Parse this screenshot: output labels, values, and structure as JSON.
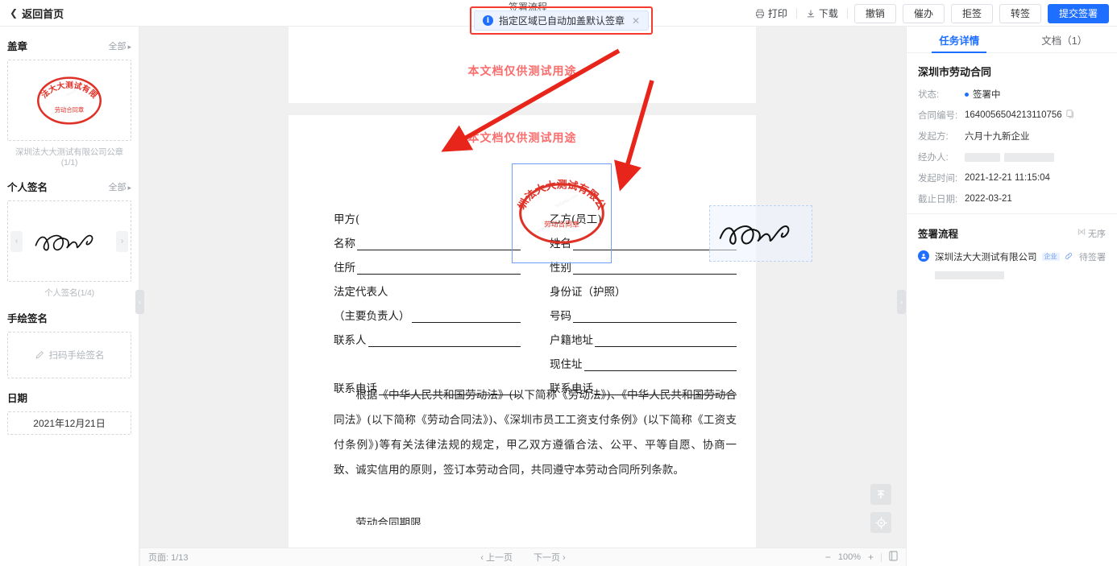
{
  "topbar": {
    "back_label": "返回首页",
    "print_label": "打印",
    "download_label": "下载",
    "buttons": [
      {
        "label": "撤销",
        "primary": false
      },
      {
        "label": "催办",
        "primary": false
      },
      {
        "label": "拒签",
        "primary": false
      },
      {
        "label": "转签",
        "primary": false
      },
      {
        "label": "提交签署",
        "primary": true
      }
    ],
    "accent_color": "#1e6fff"
  },
  "notification": {
    "text": "指定区域已自动加盖默认签章",
    "close": "✕",
    "info_glyph": "i",
    "highlight_border_color": "#f33b2f",
    "obscured_text": "签署流程"
  },
  "left_panel": {
    "seal": {
      "title": "盖章",
      "all_label": "全部",
      "caption": "深圳法大大测试有限公司公章(1/1)",
      "stamp_top_text": "深圳法大大测试有限公司",
      "stamp_bottom_text": "劳动合同章",
      "stamp_color": "#e03127"
    },
    "personal_sign": {
      "title": "个人签名",
      "all_label": "全部",
      "caption": "个人签名(1/4)",
      "prev": "‹",
      "next": "›"
    },
    "handwrite": {
      "title": "手绘签名",
      "action_label": "扫码手绘签名"
    },
    "date": {
      "title": "日期",
      "value": "2021年12月21日"
    }
  },
  "document": {
    "watermark_1": "本文档仅供测试用途",
    "watermark_2": "本文档仅供测试用途",
    "party_a_header": "甲方(",
    "party_b_header": "乙方(员工)",
    "left_fields": [
      {
        "label": "名称",
        "line": true
      },
      {
        "label": "住所",
        "line": true
      },
      {
        "label": "法定代表人",
        "line": false
      },
      {
        "label": "（主要负责人）",
        "line": true
      },
      {
        "label": "联系人",
        "line": true
      },
      {
        "label": "",
        "line": false
      },
      {
        "label": "联系电话",
        "line": true
      }
    ],
    "right_fields": [
      {
        "label": "姓名",
        "line": true
      },
      {
        "label": "性别",
        "line": true
      },
      {
        "label": "身份证（护照）",
        "line": false
      },
      {
        "label": "号码",
        "line": true
      },
      {
        "label": "户籍地址",
        "line": true
      },
      {
        "label": "现住址",
        "line": true
      },
      {
        "label": "联系电话",
        "line": true
      }
    ],
    "paragraph": "根据《中华人民共和国劳动法》(以下简称《劳动法》)、《中华人民共和国劳动合同法》(以下简称《劳动合同法》)、《深圳市员工工资支付条例》(以下简称《工资支付条例》)等有关法律法规的规定，甲乙双方遵循合法、公平、平等自愿、协商一致、诚实信用的原则，签订本劳动合同，共同遵守本劳动合同所列条款。",
    "paragraph_2": "劳动合同期限"
  },
  "bottombar": {
    "page_label": "页面: 1/13",
    "prev_page": "‹ 上一页",
    "next_page": "下一页 ›",
    "zoom_out": "−",
    "zoom_level": "100%",
    "zoom_in": "+"
  },
  "right_panel": {
    "tabs": [
      {
        "label": "任务详情",
        "active": true
      },
      {
        "label": "文档（1）",
        "active": false
      }
    ],
    "doc_title": "深圳市劳动合同",
    "details": [
      {
        "key": "状态:",
        "value": "签署中",
        "type": "status"
      },
      {
        "key": "合同编号:",
        "value": "1640056504213110756",
        "type": "copyable"
      },
      {
        "key": "发起方:",
        "value": "六月十九新企业",
        "type": "text"
      },
      {
        "key": "经办人:",
        "value": "",
        "type": "redacted"
      },
      {
        "key": "发起时间:",
        "value": "2021-12-21 11:15:04",
        "type": "text"
      },
      {
        "key": "截止日期:",
        "value": "2022-03-21",
        "type": "text"
      }
    ],
    "flow": {
      "title": "签署流程",
      "mode_label": "无序",
      "items": [
        {
          "name": "深圳法大大测试有限公司",
          "badge": "企业",
          "status": "待签署",
          "redacted": true
        }
      ]
    }
  },
  "handles": {
    "left": "‹",
    "right": "›"
  },
  "float_tools": {
    "scroll_top": "scroll-to-top",
    "locate": "locate"
  }
}
